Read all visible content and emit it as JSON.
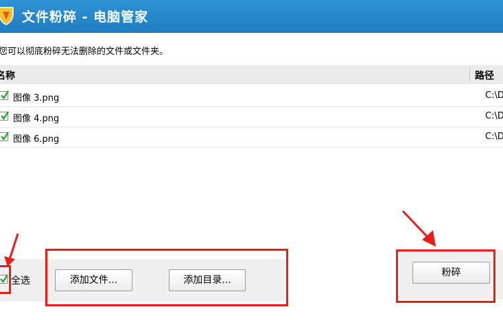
{
  "window": {
    "title": "文件粉碎 - 电脑管家",
    "logo_icon": "shield-logo-icon"
  },
  "description": "您可以彻底粉碎无法删除的文件或文件夹。",
  "table": {
    "columns": [
      "名称",
      "路径"
    ],
    "rows": [
      {
        "name": "图像 3.png",
        "path": "C:\\D",
        "checked": true
      },
      {
        "name": "图像 4.png",
        "path": "C:\\D",
        "checked": true
      },
      {
        "name": "图像 6.png",
        "path": "C:\\D",
        "checked": true
      }
    ]
  },
  "footer": {
    "select_all": {
      "label": "全选",
      "checked": true
    },
    "add_file_label": "添加文件...",
    "add_dir_label": "添加目录...",
    "shred_label": "粉碎"
  },
  "colors": {
    "titlebar": "#1f7cc0",
    "highlight": "#e61e1e",
    "check": "#2aa52a"
  }
}
